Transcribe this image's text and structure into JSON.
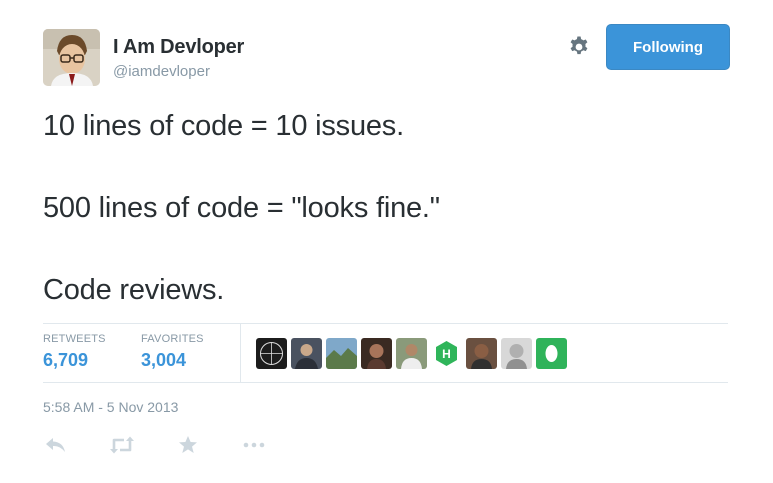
{
  "user": {
    "name": "I Am Devloper",
    "handle": "@iamdevloper"
  },
  "header": {
    "follow_label": "Following",
    "settings_icon": "gear-icon",
    "accent_color": "#3b94d9"
  },
  "tweet": {
    "lines": [
      "10 lines of code = 10 issues.",
      "500 lines of code = \"looks fine.\"",
      "Code reviews."
    ],
    "timestamp": "5:58 AM - 5 Nov 2013"
  },
  "stats": {
    "retweets_label": "RETWEETS",
    "retweets_value": "6,709",
    "favorites_label": "FAVORITES",
    "favorites_value": "3,004"
  },
  "actions": {
    "icons": [
      "reply-icon",
      "retweet-icon",
      "favorite-star-icon",
      "more-icon"
    ]
  }
}
